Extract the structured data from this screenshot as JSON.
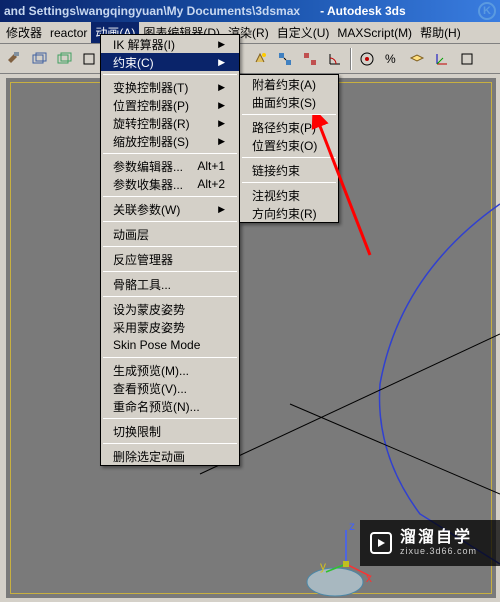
{
  "titlebar": {
    "path": "and Settings\\wangqingyuan\\My Documents\\3dsmax",
    "app": "- Autodesk 3ds"
  },
  "menubar": {
    "items": [
      {
        "label": "修改器"
      },
      {
        "label": "reactor"
      },
      {
        "label": "动画(A)"
      },
      {
        "label": "图表编辑器(D)"
      },
      {
        "label": "渲染(R)"
      },
      {
        "label": "自定义(U)"
      },
      {
        "label": "MAXScript(M)"
      },
      {
        "label": "帮助(H)"
      }
    ],
    "active_index": 2
  },
  "animation_menu": {
    "items": [
      {
        "label": "IK 解算器(I)",
        "arrow": true
      },
      {
        "label": "约束(C)",
        "arrow": true,
        "hover": true
      },
      {
        "sep": true
      },
      {
        "label": "变换控制器(T)",
        "arrow": true
      },
      {
        "label": "位置控制器(P)",
        "arrow": true
      },
      {
        "label": "旋转控制器(R)",
        "arrow": true
      },
      {
        "label": "缩放控制器(S)",
        "arrow": true
      },
      {
        "sep": true
      },
      {
        "label": "参数编辑器...",
        "shortcut": "Alt+1"
      },
      {
        "label": "参数收集器...",
        "shortcut": "Alt+2"
      },
      {
        "sep": true
      },
      {
        "label": "关联参数(W)",
        "arrow": true
      },
      {
        "sep": true
      },
      {
        "label": "动画层"
      },
      {
        "sep": true
      },
      {
        "label": "反应管理器"
      },
      {
        "sep": true
      },
      {
        "label": "骨骼工具..."
      },
      {
        "sep": true
      },
      {
        "label": "设为蒙皮姿势"
      },
      {
        "label": "采用蒙皮姿势"
      },
      {
        "label": "Skin Pose Mode"
      },
      {
        "sep": true
      },
      {
        "label": "生成预览(M)..."
      },
      {
        "label": "查看预览(V)..."
      },
      {
        "label": "重命名预览(N)..."
      },
      {
        "sep": true
      },
      {
        "label": "切换限制"
      },
      {
        "sep": true
      },
      {
        "label": "删除选定动画"
      }
    ]
  },
  "constraint_submenu": {
    "items": [
      {
        "label": "附着约束(A)"
      },
      {
        "label": "曲面约束(S)"
      },
      {
        "sep": true
      },
      {
        "label": "路径约束(P)"
      },
      {
        "label": "位置约束(O)"
      },
      {
        "sep": true
      },
      {
        "label": "链接约束"
      },
      {
        "sep": true
      },
      {
        "label": "注视约束"
      },
      {
        "label": "方向约束(R)"
      }
    ]
  },
  "gizmo": {
    "x": "x",
    "y": "y",
    "z": "z"
  },
  "watermark": {
    "brand": "溜溜自学",
    "url": "zixue.3d66.com"
  }
}
